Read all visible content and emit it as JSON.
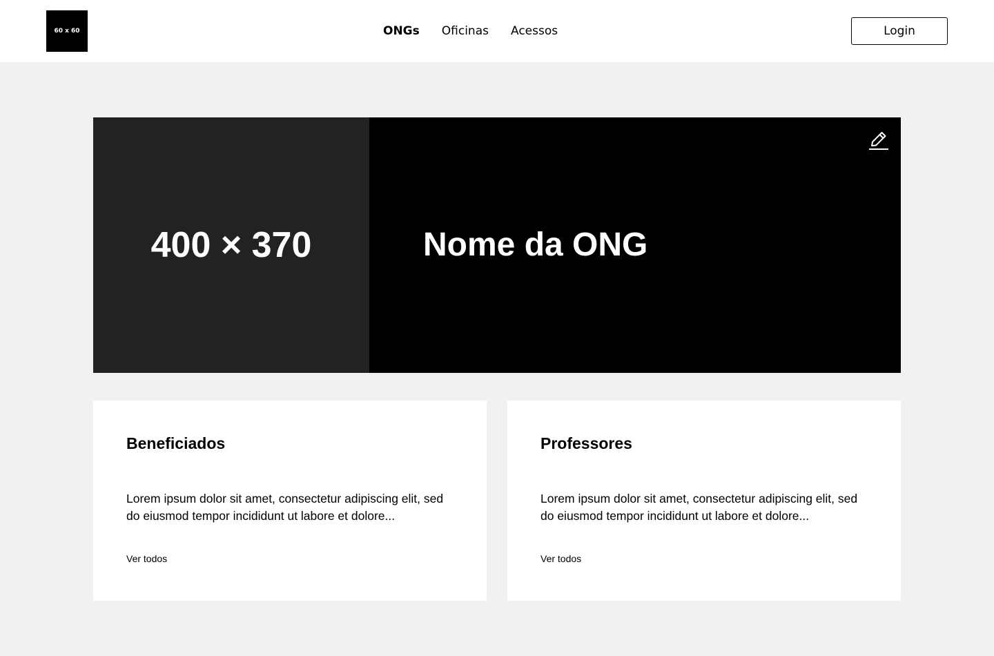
{
  "header": {
    "logo_text": "60 x 60",
    "nav": [
      {
        "label": "ONGs",
        "active": true
      },
      {
        "label": "Oficinas",
        "active": false
      },
      {
        "label": "Acessos",
        "active": false
      }
    ],
    "login_label": "Login"
  },
  "hero": {
    "image_placeholder": "400 × 370",
    "title": "Nome da ONG",
    "edit_icon": "pencil-icon",
    "colors": {
      "panel": "#000000",
      "image": "#222222",
      "text": "#ffffff"
    }
  },
  "cards": [
    {
      "title": "Beneficiados",
      "text": "Lorem ipsum dolor sit amet, consectetur adipiscing elit, sed do eiusmod tempor incididunt ut labore et dolore...",
      "link": "Ver todos"
    },
    {
      "title": "Professores",
      "text": "Lorem ipsum dolor sit amet, consectetur adipiscing elit, sed do eiusmod tempor incididunt ut labore et dolore...",
      "link": "Ver todos"
    }
  ],
  "colors": {
    "background": "#f1f1f1",
    "surface": "#ffffff",
    "text": "#000000"
  }
}
